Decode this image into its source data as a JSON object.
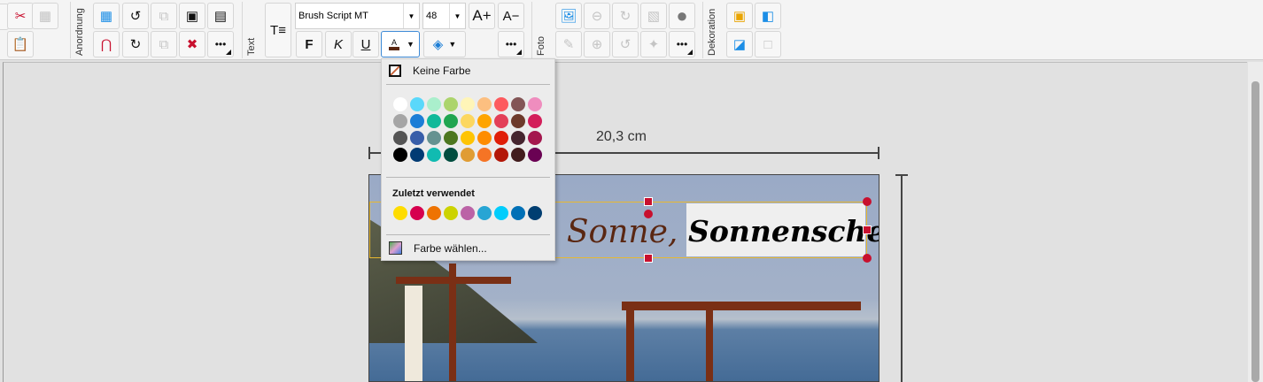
{
  "toolbar": {
    "groups": {
      "arrange": "Anordnung",
      "text": "Text",
      "photo": "Foto",
      "decoration": "Dekoration"
    },
    "font_name": "Brush Script MT",
    "font_size": "48",
    "bold_label": "F",
    "italic_label": "K",
    "underline_label": "U",
    "grow_label": "A+",
    "shrink_label": "A−",
    "more_label": "•••"
  },
  "color_menu": {
    "no_color": "Keine Farbe",
    "palette": [
      [
        "#ffffff",
        "#5ad8fb",
        "#aaefcc",
        "#acd46c",
        "#fff5b8",
        "#fcbf80",
        "#fd5a5e",
        "#835556",
        "#ef8dbe"
      ],
      [
        "#a5a5a5",
        "#1c7ed6",
        "#11b99a",
        "#21a551",
        "#fcd760",
        "#fea400",
        "#e33f58",
        "#6d3a2b",
        "#d31e5a"
      ],
      [
        "#555555",
        "#385ea9",
        "#659291",
        "#4d771f",
        "#fec403",
        "#fe8c00",
        "#e01e08",
        "#45252f",
        "#a4174e"
      ],
      [
        "#000000",
        "#013b73",
        "#11bbb1",
        "#014d3f",
        "#e09c33",
        "#f57425",
        "#b31708",
        "#421c1d",
        "#6a0253"
      ]
    ],
    "recent_label": "Zuletzt verwendet",
    "recent": [
      "#fedc00",
      "#d6004e",
      "#ee7302",
      "#ccd300",
      "#bb63a6",
      "#27a5d4",
      "#00cdfc",
      "#0070b6",
      "#003e71"
    ],
    "pick_color": "Farbe wählen..."
  },
  "canvas": {
    "width_label": "20,3 cm",
    "text_part1": ", Sonne,",
    "text_part2": "Sonnenschein",
    "text_color": "#5a2712"
  }
}
